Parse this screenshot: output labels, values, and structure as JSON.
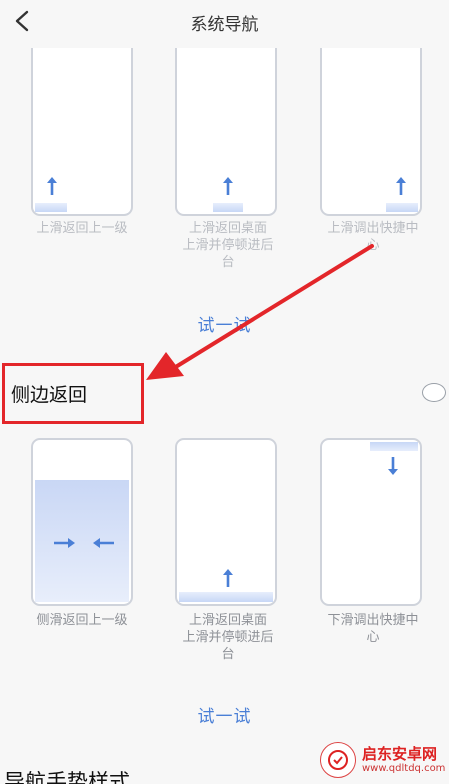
{
  "header": {
    "title": "系统导航",
    "back_icon": "chevron-left-icon"
  },
  "swipe_up": {
    "options": [
      {
        "caption": "上滑返回上一级"
      },
      {
        "caption": "上滑返回桌面\n上滑并停顿进后\n台"
      },
      {
        "caption": "上滑调出快捷中\n心"
      }
    ],
    "try_label": "试一试"
  },
  "side_back": {
    "label": "侧边返回",
    "selected": false,
    "options": [
      {
        "caption": "侧滑返回上一级"
      },
      {
        "caption": "上滑返回桌面\n上滑并停顿进后\n台"
      },
      {
        "caption": "下滑调出快捷中\n心"
      }
    ],
    "try_label": "试一试"
  },
  "next_section": {
    "title": "导航手势样式"
  },
  "annotation": {
    "box_color": "#e3262a",
    "arrow_color": "#e3262a"
  },
  "watermark": {
    "name": "启东安卓网",
    "url": "www.qdltdq.com"
  },
  "colors": {
    "accent": "#4a7fd6",
    "highlight": "#c7d7f6"
  }
}
